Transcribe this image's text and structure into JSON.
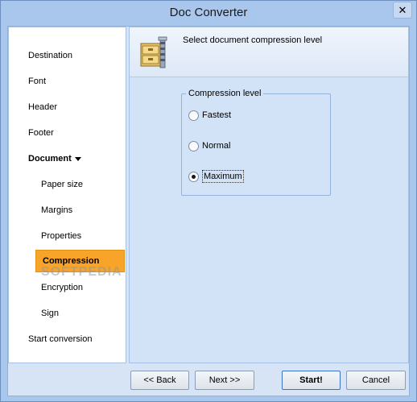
{
  "window": {
    "title": "Doc Converter",
    "close_glyph": "✕"
  },
  "nav": {
    "items": [
      {
        "label": "Destination"
      },
      {
        "label": "Font"
      },
      {
        "label": "Header"
      },
      {
        "label": "Footer"
      },
      {
        "label": "Document"
      },
      {
        "label": "Paper size"
      },
      {
        "label": "Margins"
      },
      {
        "label": "Properties"
      },
      {
        "label": "Compression"
      },
      {
        "label": "Encryption"
      },
      {
        "label": "Sign"
      },
      {
        "label": "Start conversion"
      }
    ],
    "selected": "Compression",
    "accent_color": "#f7a428"
  },
  "main": {
    "header_text": "Select document compression level",
    "header_icon": "compressed-archive-icon",
    "group": {
      "title": "Compression level",
      "options": [
        {
          "label": "Fastest",
          "checked": false
        },
        {
          "label": "Normal",
          "checked": false
        },
        {
          "label": "Maximum",
          "checked": true
        }
      ]
    }
  },
  "footer": {
    "back_label": "<< Back",
    "next_label": "Next >>",
    "start_label": "Start!",
    "cancel_label": "Cancel"
  },
  "watermark": "SOFTPEDIA"
}
